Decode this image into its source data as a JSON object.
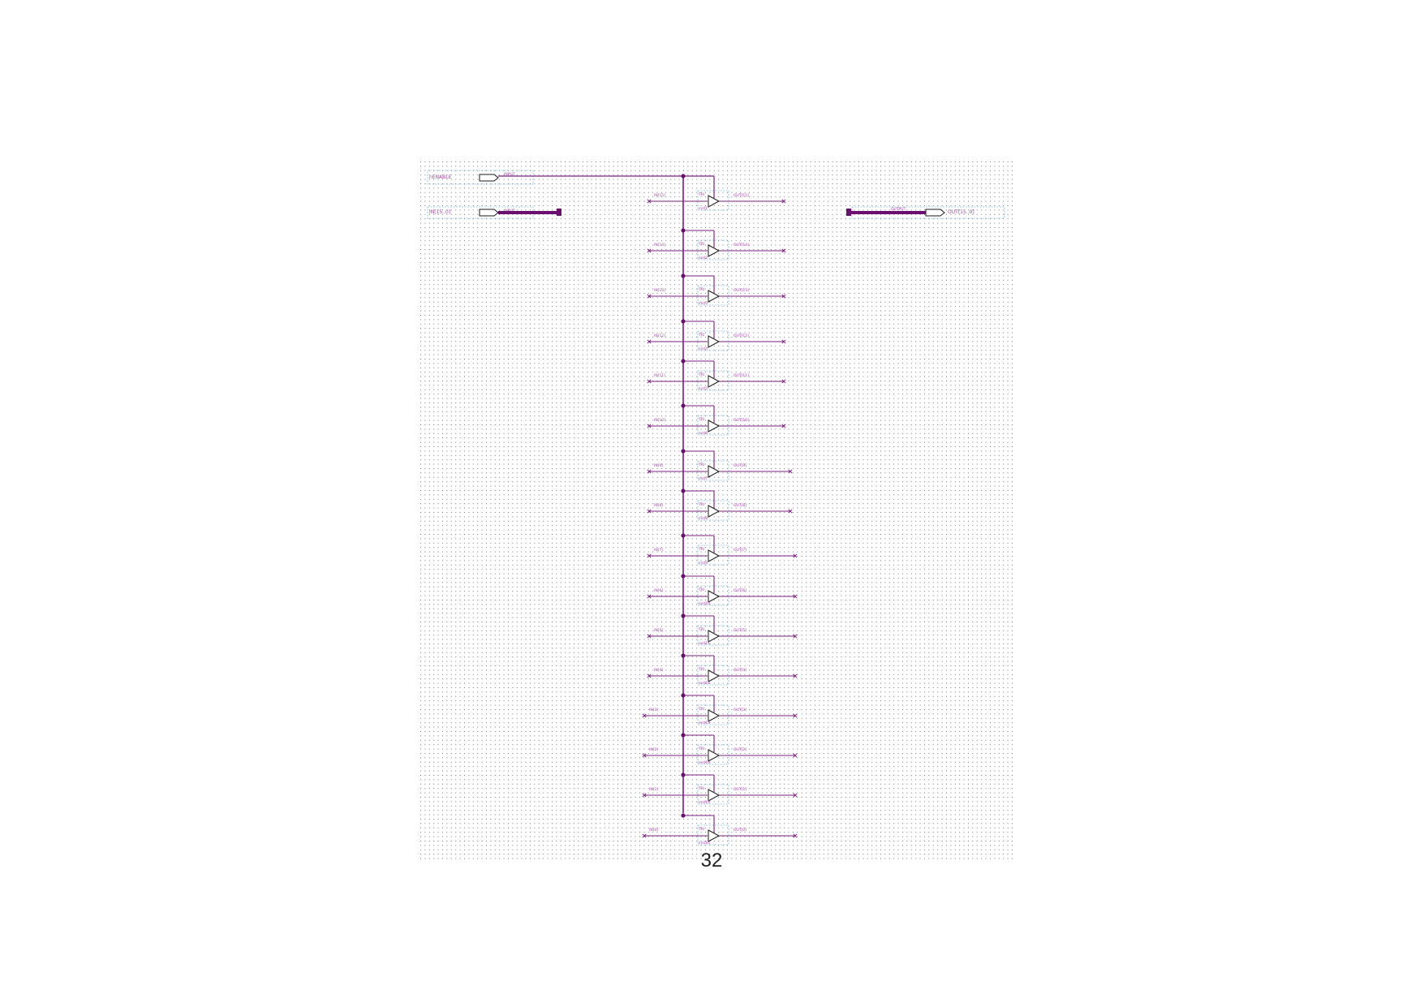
{
  "page_number": "32",
  "colors": {
    "wire": "#7b2080",
    "bus": "#6a0f70",
    "junction": "#6a0f70",
    "label": "#a24aa6",
    "boundary": "#4aa6c8",
    "grid": "#555555",
    "buffer_outline": "#1a1a1a"
  },
  "pins": {
    "enable_input": {
      "name": "nENABLE",
      "type": "INPUT",
      "icon": "input-pin-icon"
    },
    "data_input": {
      "name": "IN[15..0]",
      "type": "INPUT",
      "icon": "input-pin-icon"
    },
    "data_output": {
      "name": "OUT[15..0]",
      "type": "OUTPUT",
      "icon": "output-pin-icon"
    }
  },
  "buffers": [
    {
      "in": "IN[15]",
      "out": "OUT[15]"
    },
    {
      "in": "IN[14]",
      "out": "OUT[14]"
    },
    {
      "in": "IN[13]",
      "out": "OUT[13]"
    },
    {
      "in": "IN[12]",
      "out": "OUT[12]"
    },
    {
      "in": "IN[11]",
      "out": "OUT[11]"
    },
    {
      "in": "IN[10]",
      "out": "OUT[10]"
    },
    {
      "in": "IN[9]",
      "out": "OUT[9]"
    },
    {
      "in": "IN[8]",
      "out": "OUT[8]"
    },
    {
      "in": "IN[7]",
      "out": "OUT[7]"
    },
    {
      "in": "IN[6]",
      "out": "OUT[6]"
    },
    {
      "in": "IN[5]",
      "out": "OUT[5]"
    },
    {
      "in": "IN[4]",
      "out": "OUT[4]"
    },
    {
      "in": "IN[3]",
      "out": "OUT[3]"
    },
    {
      "in": "IN[2]",
      "out": "OUT[2]"
    },
    {
      "in": "IN[1]",
      "out": "OUT[1]"
    },
    {
      "in": "IN[0]",
      "out": "OUT[0]"
    }
  ],
  "buffer_labels": {
    "type": "TRI",
    "instance_prefix": "inst"
  }
}
